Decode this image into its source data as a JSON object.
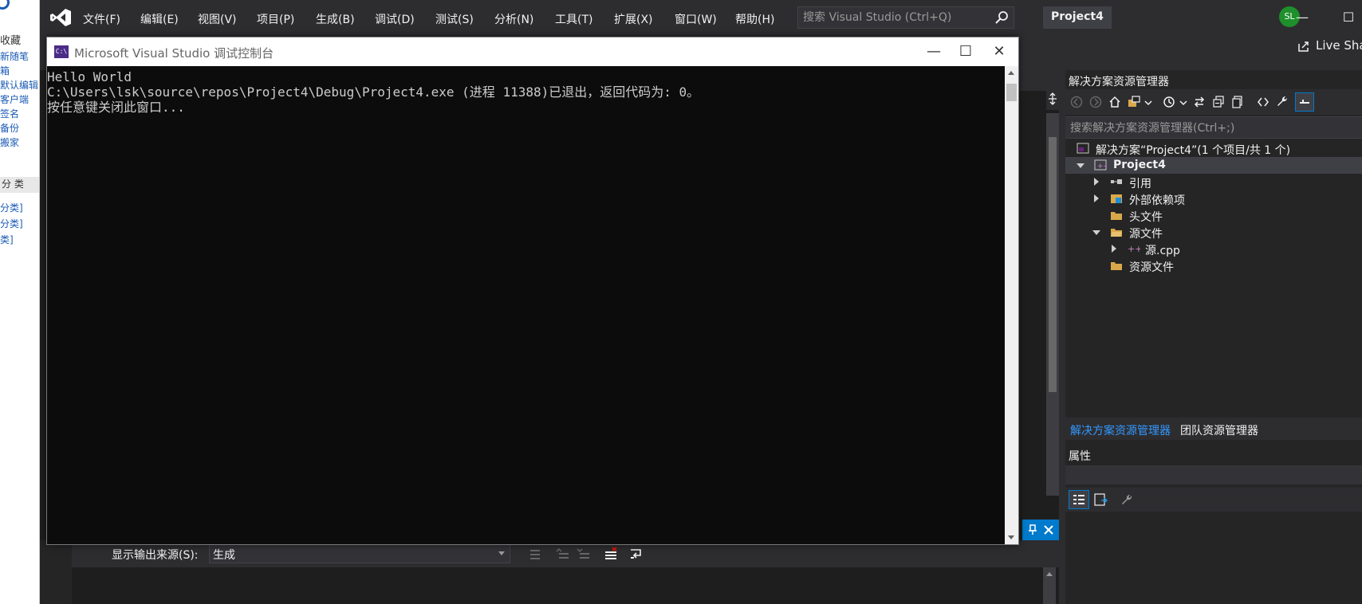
{
  "browser_strip": {
    "title": "收藏",
    "items": [
      "新随笔",
      "箱",
      "默认编辑",
      "客户端",
      "签名",
      "备份",
      "搬家"
    ],
    "category_header": "分 类",
    "category_items": [
      "分类]",
      "分类]",
      "类]"
    ]
  },
  "vs": {
    "menu": [
      "文件(F)",
      "编辑(E)",
      "视图(V)",
      "项目(P)",
      "生成(B)",
      "调试(D)",
      "测试(S)",
      "分析(N)",
      "工具(T)",
      "扩展(X)",
      "窗口(W)",
      "帮助(H)"
    ],
    "search_placeholder": "搜索 Visual Studio (Ctrl+Q)",
    "project_name": "Project4",
    "avatar_initials": "SL",
    "live_share": "Live Share",
    "window_minimize": "—",
    "window_maximize": "☐"
  },
  "console": {
    "title": "Microsoft Visual Studio 调试控制台",
    "icon_text": "C:\\",
    "minimize": "—",
    "maximize": "☐",
    "close": "✕",
    "lines": [
      "Hello World",
      "C:\\Users\\lsk\\source\\repos\\Project4\\Debug\\Project4.exe (进程 11388)已退出，返回代码为: 0。",
      "按任意键关闭此窗口..."
    ]
  },
  "output": {
    "source_label": "显示输出来源(S):",
    "source_value": "生成"
  },
  "solution_explorer": {
    "title": "解决方案资源管理器",
    "search_placeholder": "搜索解决方案资源管理器(Ctrl+;)",
    "solution_label": "解决方案“Project4”(1 个项目/共 1 个)",
    "project_label": "Project4",
    "nodes": {
      "references": "引用",
      "external_deps": "外部依赖项",
      "header_files": "头文件",
      "source_files": "源文件",
      "source_cpp": "源.cpp",
      "resource_files": "资源文件"
    },
    "tabs": [
      "解决方案资源管理器",
      "团队资源管理器"
    ]
  },
  "properties": {
    "title": "属性"
  },
  "colors": {
    "vs_bg": "#2d2d30",
    "accent": "#007acc",
    "console_bg": "#0c0c0c",
    "active_tab_text": "#3399ff"
  }
}
